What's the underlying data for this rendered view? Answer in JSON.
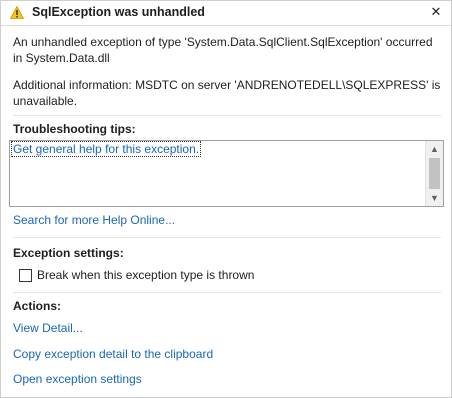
{
  "dialog": {
    "title": "SqlException was unhandled",
    "close_glyph": "✕",
    "message": "An unhandled exception of type 'System.Data.SqlClient.SqlException' occurred in System.Data.dll",
    "additional_info": "Additional information: MSDTC on server 'ANDRENOTEDELL\\SQLEXPRESS' is unavailable."
  },
  "troubleshooting": {
    "heading": "Troubleshooting tips:",
    "tip_link": "Get general help for this exception.",
    "search_link": "Search for more Help Online..."
  },
  "exception_settings": {
    "heading": "Exception settings:",
    "checkbox_label": "Break when this exception type is thrown",
    "checked": false
  },
  "actions": {
    "heading": "Actions:",
    "items": [
      "View Detail...",
      "Copy exception detail to the clipboard",
      "Open exception settings"
    ]
  },
  "colors": {
    "link": "#1a67b6",
    "warning_fill": "#f5c518"
  },
  "icons": {
    "title_icon": "warning-icon",
    "close": "close-icon",
    "scroll_up": "scroll-up-arrow-icon",
    "scroll_down": "scroll-down-arrow-icon"
  }
}
